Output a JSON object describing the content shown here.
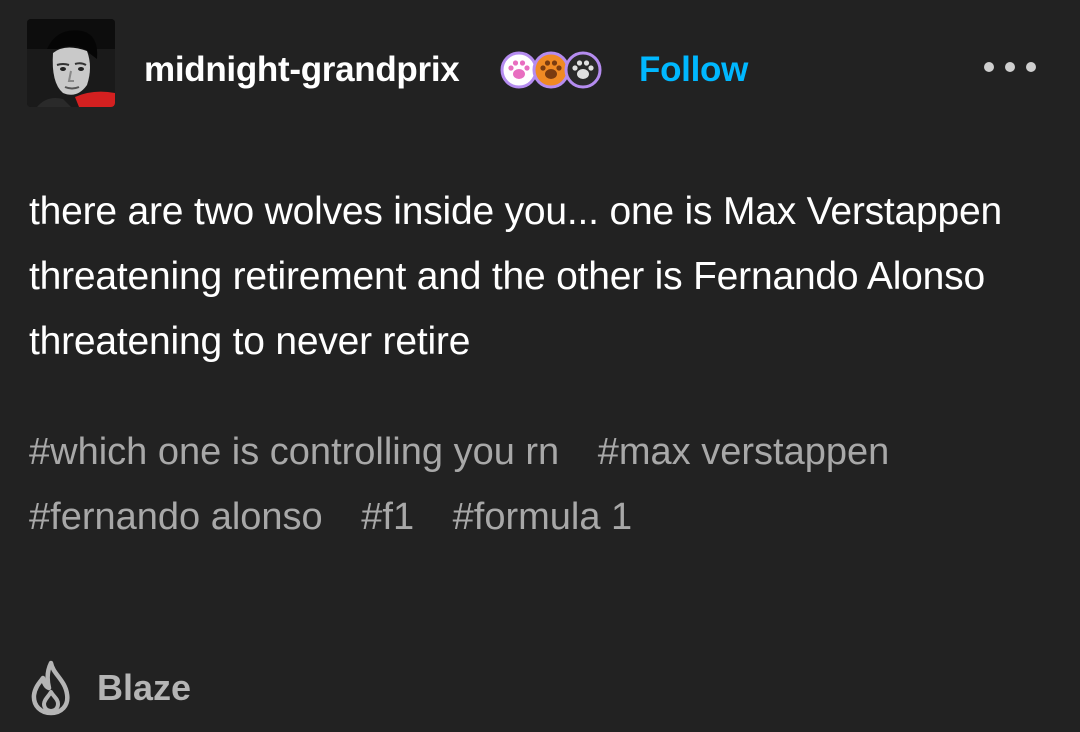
{
  "post": {
    "author": {
      "username": "midnight-grandprix",
      "avatar": "avatar-photo",
      "badges": [
        {
          "icon": "paw-print-icon",
          "color": "#ffffff",
          "ring": "#b58cf0",
          "paw": "#e86ec0"
        },
        {
          "icon": "paw-print-icon",
          "color": "#f08a24",
          "ring": "#b58cf0",
          "paw": "#7a3b10"
        },
        {
          "icon": "paw-print-icon",
          "color": "#2a2a2a",
          "ring": "#b58cf0",
          "paw": "#e0e0e0"
        }
      ]
    },
    "follow_label": "Follow",
    "more_icon": "more-options-icon",
    "body_text": "there are two wolves inside you... one is Max Verstappen threatening retirement and the other is Fernando Alonso threatening to never retire",
    "tags": [
      "#which one is controlling you rn",
      "#max verstappen",
      "#fernando alonso",
      "#f1",
      "#formula 1"
    ],
    "footer": {
      "blaze_label": "Blaze",
      "blaze_icon": "flame-icon"
    }
  },
  "colors": {
    "background": "#222222",
    "accent": "#00b8ff",
    "text": "#ffffff",
    "tag_text": "#a8a8a8"
  }
}
